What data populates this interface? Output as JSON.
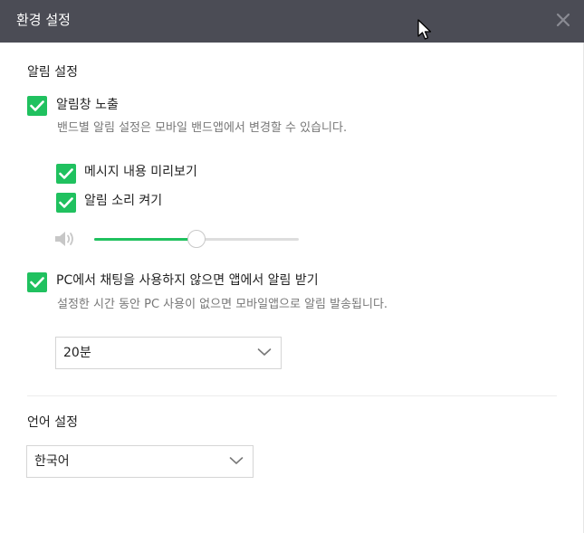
{
  "window": {
    "title": "환경 설정"
  },
  "notifications": {
    "section_title": "알림 설정",
    "show_popup": {
      "label": "알림창 노출",
      "checked": true,
      "description": "밴드별 알림 설정은 모바일 밴드앱에서 변경할 수 있습니다."
    },
    "preview_message": {
      "label": "메시지 내용 미리보기",
      "checked": true
    },
    "sound_on": {
      "label": "알림 소리 켜기",
      "checked": true
    },
    "volume": {
      "icon": "speaker-icon",
      "level": 0.5
    },
    "pc_idle": {
      "label": "PC에서 채팅을 사용하지 않으면 앱에서 알림 받기",
      "checked": true,
      "description": "설정한 시간 동안 PC 사용이 없으면 모바일앱으로 알림 발송됩니다.",
      "selected_value": "20분"
    }
  },
  "language": {
    "section_title": "언어 설정",
    "selected_value": "한국어"
  },
  "colors": {
    "titlebar": "#4b4c55",
    "accent": "#20c15f"
  }
}
